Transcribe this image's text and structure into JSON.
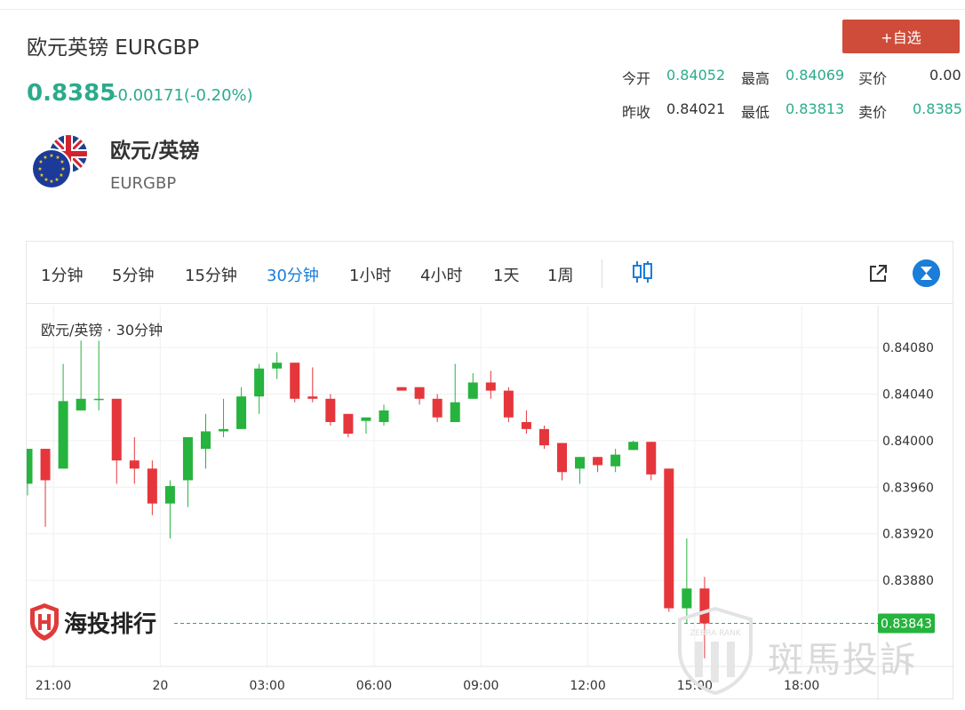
{
  "header": {
    "title": "欧元英镑 EURGBP",
    "price": "0.8385",
    "change": "-0.00171(-0.20%)",
    "add_button": "+自选"
  },
  "stats": {
    "open_label": "今开",
    "open_value": "0.84052",
    "high_label": "最高",
    "high_value": "0.84069",
    "bid_label": "买价",
    "bid_value": "0.00",
    "prev_close_label": "昨收",
    "prev_close_value": "0.84021",
    "low_label": "最低",
    "low_value": "0.83813",
    "ask_label": "卖价",
    "ask_value": "0.8385"
  },
  "instrument": {
    "name": "欧元/英镑",
    "code": "EURGBP"
  },
  "toolbar": {
    "timeframes": [
      "1分钟",
      "5分钟",
      "15分钟",
      "30分钟",
      "1小时",
      "4小时",
      "1天",
      "1周"
    ],
    "active_index": 3
  },
  "chart_label": "欧元/英镑 · 30分钟",
  "watermarks": {
    "left": "海投排行",
    "right": "斑馬投訴",
    "badge": "ZEBRA RANK"
  },
  "colors": {
    "up": "#26b33e",
    "down": "#e5363c",
    "accent": "#2bab8b",
    "active_tab": "#1a7dd8",
    "button": "#cf4c3a",
    "last_price_line": "#26b33e"
  },
  "chart_data": {
    "type": "candlestick",
    "title": "欧元/英镑 · 30分钟",
    "yticks": [
      0.8408,
      0.8404,
      0.84,
      0.8396,
      0.8392,
      0.8388
    ],
    "ytick_labels": [
      "0.84080",
      "0.84040",
      "0.84000",
      "0.83960",
      "0.83920",
      "0.83880"
    ],
    "ylim": [
      0.83806,
      0.84116
    ],
    "xtick_labels": [
      "21:00",
      "20",
      "03:00",
      "06:00",
      "09:00",
      "12:00",
      "15:00",
      "18:00"
    ],
    "xtick_candle_index": [
      1.5,
      7.5,
      13.5,
      19.5,
      25.5,
      31.5,
      37.5,
      43.5
    ],
    "last_price": 0.83843,
    "last_price_label": "0.83843",
    "grid": true,
    "candles": [
      {
        "o": 0.83963,
        "h": 0.83993,
        "l": 0.83953,
        "c": 0.83993
      },
      {
        "o": 0.83993,
        "h": 0.83993,
        "l": 0.83926,
        "c": 0.83966
      },
      {
        "o": 0.83976,
        "h": 0.84066,
        "l": 0.83976,
        "c": 0.84034
      },
      {
        "o": 0.84026,
        "h": 0.84086,
        "l": 0.84026,
        "c": 0.84036
      },
      {
        "o": 0.84036,
        "h": 0.84086,
        "l": 0.84026,
        "c": 0.84036
      },
      {
        "o": 0.84036,
        "h": 0.84036,
        "l": 0.83963,
        "c": 0.83983
      },
      {
        "o": 0.83983,
        "h": 0.84003,
        "l": 0.83963,
        "c": 0.83976
      },
      {
        "o": 0.83976,
        "h": 0.83983,
        "l": 0.83936,
        "c": 0.83946
      },
      {
        "o": 0.83946,
        "h": 0.83966,
        "l": 0.83916,
        "c": 0.83961
      },
      {
        "o": 0.83966,
        "h": 0.84003,
        "l": 0.83943,
        "c": 0.84003
      },
      {
        "o": 0.83993,
        "h": 0.84023,
        "l": 0.83976,
        "c": 0.84008
      },
      {
        "o": 0.84008,
        "h": 0.84036,
        "l": 0.84003,
        "c": 0.8401
      },
      {
        "o": 0.8401,
        "h": 0.84046,
        "l": 0.8401,
        "c": 0.84038
      },
      {
        "o": 0.84038,
        "h": 0.84066,
        "l": 0.84023,
        "c": 0.84062
      },
      {
        "o": 0.84062,
        "h": 0.84076,
        "l": 0.84053,
        "c": 0.84067
      },
      {
        "o": 0.84067,
        "h": 0.84067,
        "l": 0.84033,
        "c": 0.84036
      },
      {
        "o": 0.84038,
        "h": 0.84063,
        "l": 0.84033,
        "c": 0.84036
      },
      {
        "o": 0.84036,
        "h": 0.8404,
        "l": 0.84013,
        "c": 0.84016
      },
      {
        "o": 0.84023,
        "h": 0.84023,
        "l": 0.84003,
        "c": 0.84006
      },
      {
        "o": 0.84017,
        "h": 0.84017,
        "l": 0.84006,
        "c": 0.8402
      },
      {
        "o": 0.84016,
        "h": 0.84031,
        "l": 0.84013,
        "c": 0.84026
      },
      {
        "o": 0.84046,
        "h": 0.84046,
        "l": 0.84043,
        "c": 0.84043
      },
      {
        "o": 0.84046,
        "h": 0.84046,
        "l": 0.84031,
        "c": 0.84036
      },
      {
        "o": 0.84036,
        "h": 0.8404,
        "l": 0.84016,
        "c": 0.8402
      },
      {
        "o": 0.84016,
        "h": 0.84066,
        "l": 0.84016,
        "c": 0.84033
      },
      {
        "o": 0.84036,
        "h": 0.84058,
        "l": 0.84036,
        "c": 0.8405
      },
      {
        "o": 0.8405,
        "h": 0.8406,
        "l": 0.84036,
        "c": 0.84043
      },
      {
        "o": 0.84043,
        "h": 0.84046,
        "l": 0.84016,
        "c": 0.8402
      },
      {
        "o": 0.84016,
        "h": 0.84026,
        "l": 0.84006,
        "c": 0.8401
      },
      {
        "o": 0.8401,
        "h": 0.84013,
        "l": 0.83993,
        "c": 0.83996
      },
      {
        "o": 0.83998,
        "h": 0.83998,
        "l": 0.83966,
        "c": 0.83973
      },
      {
        "o": 0.83976,
        "h": 0.83986,
        "l": 0.83963,
        "c": 0.83986
      },
      {
        "o": 0.83986,
        "h": 0.83986,
        "l": 0.83973,
        "c": 0.83979
      },
      {
        "o": 0.83978,
        "h": 0.83993,
        "l": 0.83973,
        "c": 0.83988
      },
      {
        "o": 0.83992,
        "h": 0.84,
        "l": 0.83992,
        "c": 0.83999
      },
      {
        "o": 0.83999,
        "h": 0.83999,
        "l": 0.83966,
        "c": 0.83971
      },
      {
        "o": 0.83976,
        "h": 0.83976,
        "l": 0.83853,
        "c": 0.83856
      },
      {
        "o": 0.83856,
        "h": 0.83916,
        "l": 0.83843,
        "c": 0.83873
      },
      {
        "o": 0.83873,
        "h": 0.83883,
        "l": 0.83813,
        "c": 0.83843
      }
    ]
  }
}
